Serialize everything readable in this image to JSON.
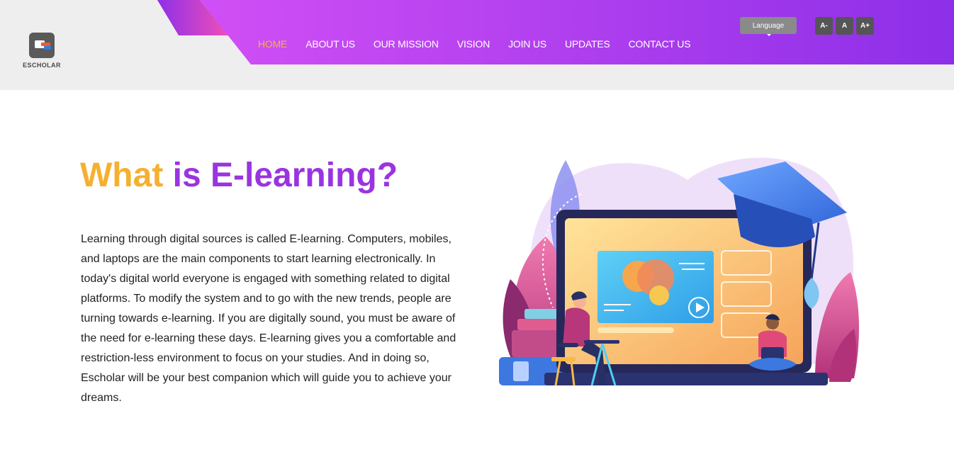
{
  "header": {
    "logo_label": "ESCHOLAR",
    "language_button": "Language",
    "font_controls": [
      "A-",
      "A",
      "A+"
    ],
    "nav": [
      {
        "label": "HOME",
        "active": true
      },
      {
        "label": "ABOUT US",
        "active": false
      },
      {
        "label": "OUR MISSION",
        "active": false
      },
      {
        "label": "VISION",
        "active": false
      },
      {
        "label": "JOIN US",
        "active": false
      },
      {
        "label": "UPDATES",
        "active": false
      },
      {
        "label": "CONTACT US",
        "active": false
      }
    ]
  },
  "main": {
    "heading_part1": "What",
    "heading_part2": "is E-learning?",
    "paragraph": "Learning through digital sources is called E-learning. Computers, mobiles, and laptops are the main components to start learning electronically. In today's digital world everyone is engaged with something related to digital platforms. To modify the system and to go with the new trends, people are turning towards e-learning. If you are digitally sound, you must be aware of the need for e-learning these days. E-learning gives you a comfortable and restriction-less environment to focus on your studies. And in doing so, Escholar will be your best companion which will guide you to achieve your dreams."
  },
  "colors": {
    "nav_gradient_start": "#d14ff5",
    "nav_gradient_end": "#8d2fe8",
    "active_nav": "#f6b23c",
    "heading_accent": "#f5b030",
    "heading_main": "#9a34e0"
  },
  "icons": {
    "logo": "escholar-logo-icon",
    "illustration": "e-learning-laptop-illustration"
  }
}
